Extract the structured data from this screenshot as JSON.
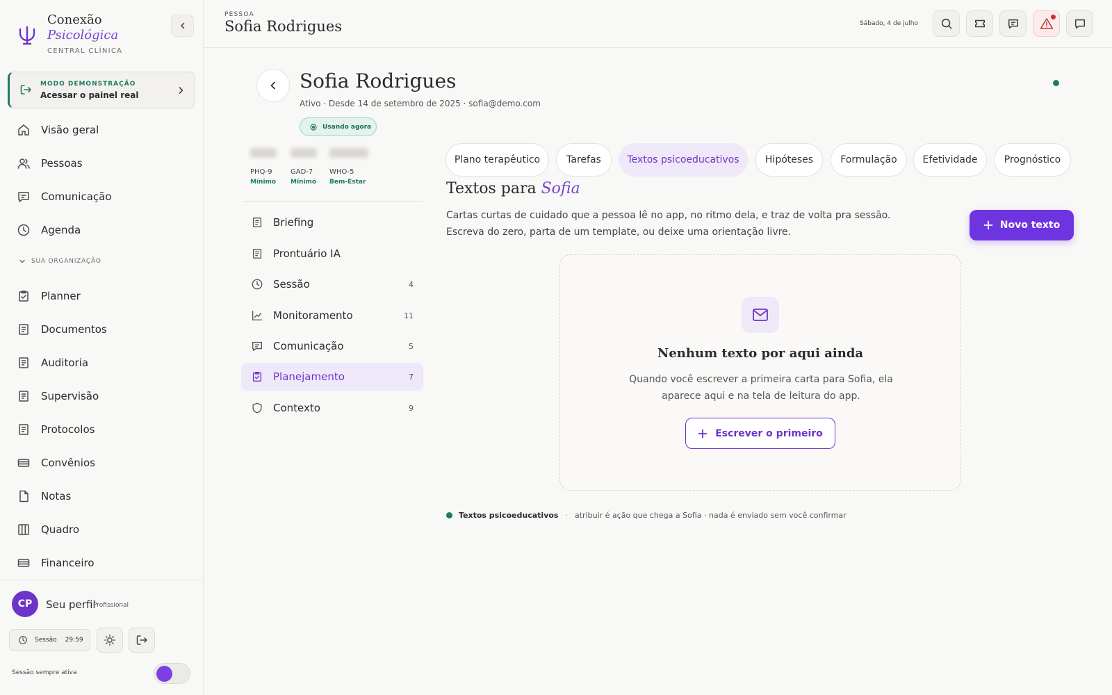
{
  "brand": {
    "line1": "Conexão",
    "line2": "Psicológica",
    "line3": "CENTRAL CLÍNICA"
  },
  "demo": {
    "label": "MODO DEMONSTRAÇÃO",
    "action": "Acessar o painel real"
  },
  "nav": {
    "primary": [
      {
        "label": "Visão geral",
        "icon": "home-icon"
      },
      {
        "label": "Pessoas",
        "icon": "users-icon"
      },
      {
        "label": "Comunicação",
        "icon": "chat-icon"
      },
      {
        "label": "Agenda",
        "icon": "clock-icon"
      }
    ],
    "org_header": "SUA ORGANIZAÇÃO",
    "org": [
      {
        "label": "Planner",
        "icon": "clipboard-check-icon"
      },
      {
        "label": "Documentos",
        "icon": "document-icon"
      },
      {
        "label": "Auditoria",
        "icon": "document-icon"
      },
      {
        "label": "Supervisão",
        "icon": "document-icon"
      },
      {
        "label": "Protocolos",
        "icon": "document-icon"
      },
      {
        "label": "Convênios",
        "icon": "card-icon"
      },
      {
        "label": "Notas",
        "icon": "file-icon"
      },
      {
        "label": "Quadro",
        "icon": "columns-icon"
      },
      {
        "label": "Financeiro",
        "icon": "card-icon"
      }
    ]
  },
  "profile": {
    "initials": "CP",
    "name": "Seu perfil",
    "role": "Profissional",
    "session_label": "Sessão",
    "session_time": "29:59",
    "always_active": "Sessão sempre ativa",
    "always_active_on": true
  },
  "header": {
    "crumb": "PESSOA",
    "title": "Sofia Rodrigues",
    "date": "Sábado, 4 de julho"
  },
  "patient": {
    "name": "Sofia Rodrigues",
    "meta": "Ativo · Desde 14 de setembro de 2025 · sofia@demo.com",
    "status": "Usando agora",
    "scales": [
      {
        "name": "PHQ-9",
        "severity": "Mínimo"
      },
      {
        "name": "GAD-7",
        "severity": "Mínimo"
      },
      {
        "name": "WHO-5",
        "severity": "Bem-Estar"
      }
    ]
  },
  "side_nav": [
    {
      "label": "Briefing",
      "count": "",
      "icon": "document-icon"
    },
    {
      "label": "Prontuário IA",
      "count": "",
      "icon": "document-icon"
    },
    {
      "label": "Sessão",
      "count": "4",
      "icon": "clock-icon"
    },
    {
      "label": "Monitoramento",
      "count": "11",
      "icon": "chart-line-icon"
    },
    {
      "label": "Comunicação",
      "count": "5",
      "icon": "chat-icon"
    },
    {
      "label": "Planejamento",
      "count": "7",
      "icon": "clipboard-check-icon"
    },
    {
      "label": "Contexto",
      "count": "9",
      "icon": "shield-icon"
    }
  ],
  "tabs": [
    {
      "label": "Plano terapêutico"
    },
    {
      "label": "Tarefas"
    },
    {
      "label": "Textos psicoeducativos"
    },
    {
      "label": "Hipóteses"
    },
    {
      "label": "Formulação"
    },
    {
      "label": "Efetividade"
    },
    {
      "label": "Prognóstico"
    }
  ],
  "section": {
    "title_prefix": "Textos para",
    "title_name": "Sofia",
    "desc_line1": "Cartas curtas de cuidado que a pessoa lê no app, no ritmo dela, e traz de volta pra sessão.",
    "desc_line2": "Escreva do zero, parta de um template, ou deixe uma orientação livre.",
    "new_button": "Novo texto"
  },
  "empty": {
    "title": "Nenhum texto por aqui ainda",
    "desc_line1": "Quando você escrever a primeira carta para Sofia, ela",
    "desc_line2": "aparece aqui e na tela de leitura do app.",
    "button": "Escrever o primeiro"
  },
  "footnote": {
    "strong": "Textos psicoeducativos",
    "separator": "·",
    "text": "atribuir é ação que chega a Sofia · nada é enviado sem você confirmar"
  },
  "colors": {
    "accent": "#6d34e0",
    "accent_text": "#6d34c9",
    "success": "#1f7a63",
    "alert": "#d22f2f"
  }
}
